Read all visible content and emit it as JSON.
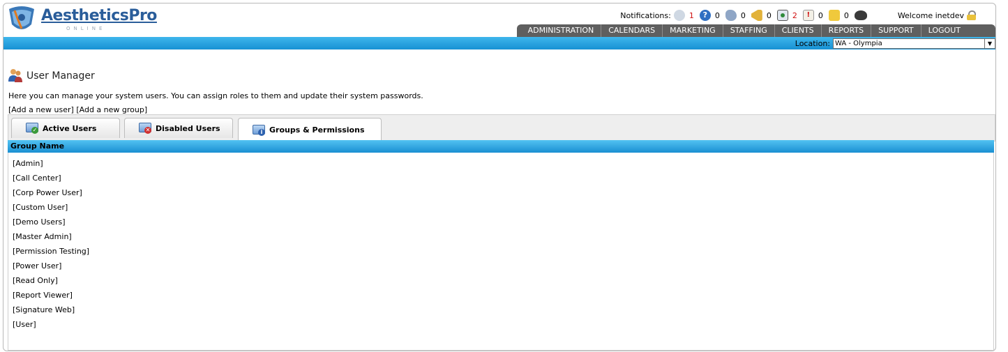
{
  "header": {
    "logo_main": "AestheticsPro",
    "logo_sub": "ONLINE",
    "notifications_label": "Notifications:",
    "notifications": [
      {
        "icon": "chat-bubble-icon",
        "count": "1",
        "red": true
      },
      {
        "icon": "help-circle-icon",
        "count": "0",
        "red": false
      },
      {
        "icon": "footprints-icon",
        "count": "0",
        "red": false
      },
      {
        "icon": "megaphone-icon",
        "count": "0",
        "red": false
      },
      {
        "icon": "monitor-alert-icon",
        "count": "2",
        "red": true
      },
      {
        "icon": "alert-note-icon",
        "count": "0",
        "red": false
      },
      {
        "icon": "sticky-note-icon",
        "count": "0",
        "red": false
      },
      {
        "icon": "binoculars-icon",
        "count": "",
        "red": false
      }
    ],
    "welcome": "Welcome inetdev"
  },
  "nav": [
    "ADMINISTRATION",
    "CALENDARS",
    "MARKETING",
    "STAFFING",
    "CLIENTS",
    "REPORTS",
    "SUPPORT",
    "LOGOUT"
  ],
  "location": {
    "label": "Location:",
    "value": "WA - Olympia"
  },
  "page": {
    "title": "User Manager",
    "description": "Here you can manage your system users. You can assign roles to them and update their system passwords.",
    "add_user": "[Add a new user]",
    "add_group": "[Add a new group]"
  },
  "tabs": [
    {
      "label": "Active Users",
      "icon": "users-check-icon",
      "active": false
    },
    {
      "label": "Disabled Users",
      "icon": "users-disabled-icon",
      "active": false
    },
    {
      "label": "Groups & Permissions",
      "icon": "groups-info-icon",
      "active": true
    }
  ],
  "table": {
    "header": "Group Name",
    "rows": [
      "[Admin]",
      "[Call Center]",
      "[Corp Power User]",
      "[Custom User]",
      "[Demo Users]",
      "[Master Admin]",
      "[Permission Testing]",
      "[Power User]",
      "[Read Only]",
      "[Report Viewer]",
      "[Signature Web]",
      "[User]"
    ]
  },
  "colors": {
    "accent_blue": "#1a8fd2",
    "nav_bg": "#5f5f5f",
    "logo_blue": "#2a5d9a",
    "alert_red": "#d01010"
  }
}
